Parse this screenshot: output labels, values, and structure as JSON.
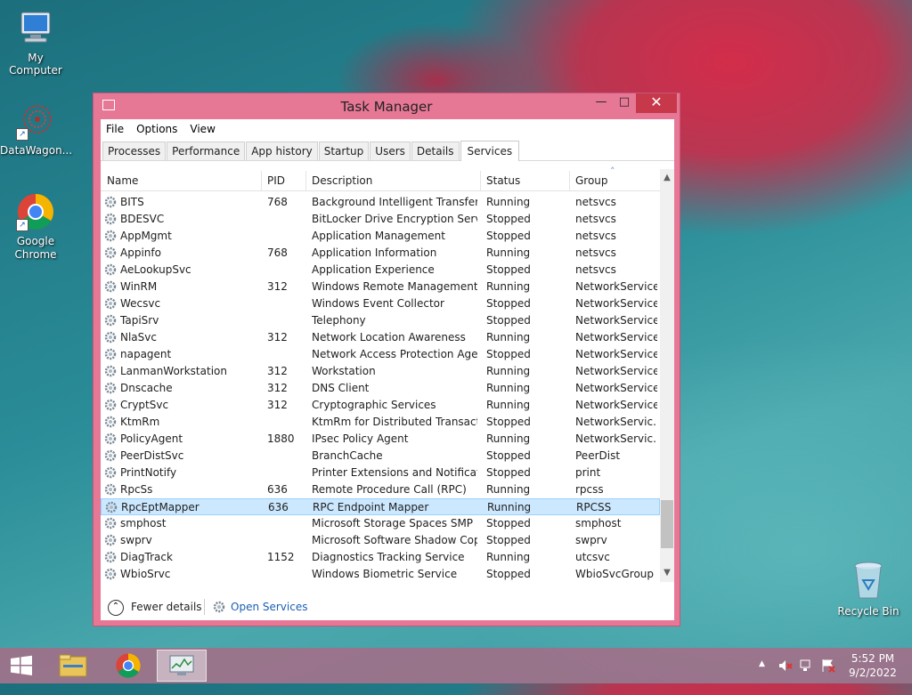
{
  "desktop": {
    "icons": [
      {
        "label": "My Computer"
      },
      {
        "label": "DataWagon..."
      },
      {
        "label": "Google Chrome"
      },
      {
        "label": "Recycle Bin"
      }
    ]
  },
  "window": {
    "title": "Task Manager",
    "buttons": {
      "minimize": "—",
      "maximize": "□",
      "close": "✕"
    }
  },
  "menu": [
    "File",
    "Options",
    "View"
  ],
  "tabs": [
    "Processes",
    "Performance",
    "App history",
    "Startup",
    "Users",
    "Details",
    "Services"
  ],
  "active_tab": "Services",
  "columns": [
    "Name",
    "PID",
    "Description",
    "Status",
    "Group"
  ],
  "sort_indicator": "˄",
  "services": [
    {
      "name": "BITS",
      "pid": "768",
      "description": "Background Intelligent Transfer ...",
      "status": "Running",
      "group": "netsvcs"
    },
    {
      "name": "BDESVC",
      "pid": "",
      "description": "BitLocker Drive Encryption Service",
      "status": "Stopped",
      "group": "netsvcs"
    },
    {
      "name": "AppMgmt",
      "pid": "",
      "description": "Application Management",
      "status": "Stopped",
      "group": "netsvcs"
    },
    {
      "name": "Appinfo",
      "pid": "768",
      "description": "Application Information",
      "status": "Running",
      "group": "netsvcs"
    },
    {
      "name": "AeLookupSvc",
      "pid": "",
      "description": "Application Experience",
      "status": "Stopped",
      "group": "netsvcs"
    },
    {
      "name": "WinRM",
      "pid": "312",
      "description": "Windows Remote Management ...",
      "status": "Running",
      "group": "NetworkService"
    },
    {
      "name": "Wecsvc",
      "pid": "",
      "description": "Windows Event Collector",
      "status": "Stopped",
      "group": "NetworkService"
    },
    {
      "name": "TapiSrv",
      "pid": "",
      "description": "Telephony",
      "status": "Stopped",
      "group": "NetworkService"
    },
    {
      "name": "NlaSvc",
      "pid": "312",
      "description": "Network Location Awareness",
      "status": "Running",
      "group": "NetworkService"
    },
    {
      "name": "napagent",
      "pid": "",
      "description": "Network Access Protection Agent",
      "status": "Stopped",
      "group": "NetworkService"
    },
    {
      "name": "LanmanWorkstation",
      "pid": "312",
      "description": "Workstation",
      "status": "Running",
      "group": "NetworkService"
    },
    {
      "name": "Dnscache",
      "pid": "312",
      "description": "DNS Client",
      "status": "Running",
      "group": "NetworkService"
    },
    {
      "name": "CryptSvc",
      "pid": "312",
      "description": "Cryptographic Services",
      "status": "Running",
      "group": "NetworkService"
    },
    {
      "name": "KtmRm",
      "pid": "",
      "description": "KtmRm for Distributed Transacti...",
      "status": "Stopped",
      "group": "NetworkServic..."
    },
    {
      "name": "PolicyAgent",
      "pid": "1880",
      "description": "IPsec Policy Agent",
      "status": "Running",
      "group": "NetworkServic..."
    },
    {
      "name": "PeerDistSvc",
      "pid": "",
      "description": "BranchCache",
      "status": "Stopped",
      "group": "PeerDist"
    },
    {
      "name": "PrintNotify",
      "pid": "",
      "description": "Printer Extensions and Notificati...",
      "status": "Stopped",
      "group": "print"
    },
    {
      "name": "RpcSs",
      "pid": "636",
      "description": "Remote Procedure Call (RPC)",
      "status": "Running",
      "group": "rpcss"
    },
    {
      "name": "RpcEptMapper",
      "pid": "636",
      "description": "RPC Endpoint Mapper",
      "status": "Running",
      "group": "RPCSS",
      "selected": true
    },
    {
      "name": "smphost",
      "pid": "",
      "description": "Microsoft Storage Spaces SMP",
      "status": "Stopped",
      "group": "smphost"
    },
    {
      "name": "swprv",
      "pid": "",
      "description": "Microsoft Software Shadow Cop...",
      "status": "Stopped",
      "group": "swprv"
    },
    {
      "name": "DiagTrack",
      "pid": "1152",
      "description": "Diagnostics Tracking Service",
      "status": "Running",
      "group": "utcsvc"
    },
    {
      "name": "WbioSrvc",
      "pid": "",
      "description": "Windows Biometric Service",
      "status": "Stopped",
      "group": "WbioSvcGroup"
    }
  ],
  "footer": {
    "fewer_details": "Fewer details",
    "open_services": "Open Services"
  },
  "taskbar": {
    "time": "5:52 PM",
    "date": "9/2/2022"
  },
  "colors": {
    "window_frame": "#e67896",
    "close_button": "#c7384a",
    "selection": "#cce8ff",
    "link": "#1a5fb4"
  }
}
